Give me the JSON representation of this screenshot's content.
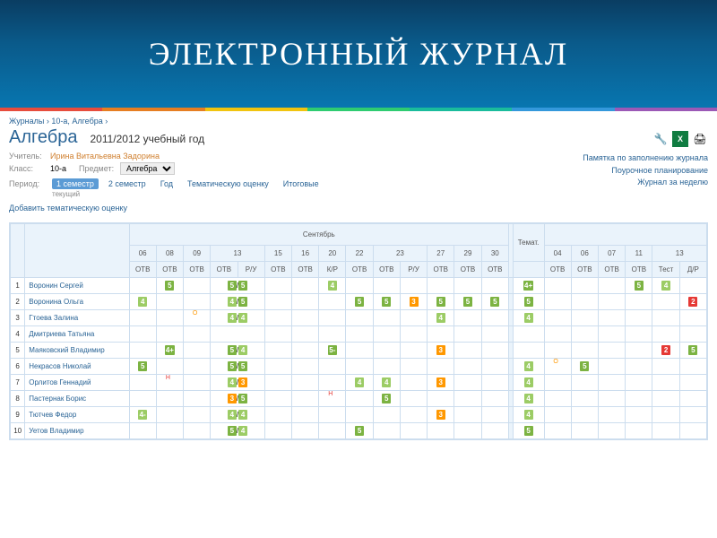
{
  "banner": {
    "title": "ЭЛЕКТРОННЫЙ ЖУРНАЛ"
  },
  "breadcrumb": {
    "journals": "Журналы",
    "class": "10-а, Алгебра"
  },
  "header": {
    "subject": "Алгебра",
    "year": "2011/2012 учебный год",
    "teacher_label": "Учитель:",
    "teacher": "Ирина Витальевна Задорина",
    "class_label": "Класс:",
    "class": "10-а",
    "subject_label": "Предмет:",
    "subject_select": "Алгебра",
    "period_label": "Период:",
    "period_tabs": [
      "1 семестр",
      "2 семестр",
      "Год",
      "Тематическую оценку",
      "Итоговые"
    ],
    "period_sub": "текущий",
    "add_thematic": "Добавить тематическую оценку"
  },
  "links": {
    "memo": "Памятка по заполнению журнала",
    "planning": "Поурочное планирование",
    "week": "Журнал за неделю"
  },
  "columns": {
    "month": "Сентябрь",
    "dates": [
      "06",
      "08",
      "09",
      "13",
      "15",
      "16",
      "20",
      "22",
      "23",
      "27",
      "29",
      "30"
    ],
    "types": [
      "ОТВ",
      "ОТВ",
      "ОТВ",
      "ОТВ",
      "Р/У",
      "ОТВ",
      "ОТВ",
      "К/Р",
      "ОТВ",
      "ОТВ",
      "Р/У",
      "ОТВ",
      "ОТВ",
      "ОТВ"
    ],
    "themat": "Темат.",
    "dates2": [
      "04",
      "06",
      "07",
      "11",
      "13"
    ],
    "types2": [
      "ОТВ",
      "ОТВ",
      "ОТВ",
      "ОТВ",
      "Тест",
      "Д/Р"
    ]
  },
  "students": [
    {
      "n": "1",
      "name": "Воронин Сергей"
    },
    {
      "n": "2",
      "name": "Воронина Ольга"
    },
    {
      "n": "3",
      "name": "Гтоева Залина"
    },
    {
      "n": "4",
      "name": "Дмитриева Татьяна"
    },
    {
      "n": "5",
      "name": "Маяковский Владимир"
    },
    {
      "n": "6",
      "name": "Некрасов Николай"
    },
    {
      "n": "7",
      "name": "Орлитов Геннадий"
    },
    {
      "n": "8",
      "name": "Пастернак Борис"
    },
    {
      "n": "9",
      "name": "Тютчев Федор"
    },
    {
      "n": "10",
      "name": "Уетов Владимир"
    }
  ],
  "grades": {
    "r1": {
      "c2": "5",
      "c4": "5/5",
      "c8": "4",
      "c15": "4+",
      "c19": "5",
      "c20": "4"
    },
    "r2": {
      "c1": "4",
      "c4": "4/5",
      "c9": "5",
      "c10": "5",
      "c11": "3",
      "c12": "5",
      "c13": "5",
      "c14": "5",
      "c15": "5",
      "c21": "2"
    },
    "r3": {
      "c3o": "О",
      "c4": "4/4",
      "c12": "4",
      "c15": "4"
    },
    "r4": {},
    "r5": {
      "c2": "4+",
      "c4": "5/4",
      "c8": "5-",
      "c12": "3",
      "c20": "2",
      "c21": "5"
    },
    "r6": {
      "c1": "5",
      "c4": "5/5",
      "c15": "4",
      "c16o": "О",
      "c17": "5"
    },
    "r7": {
      "c2n": "Н",
      "c4": "4/3",
      "c9": "4",
      "c10": "4",
      "c12": "3",
      "c15": "4"
    },
    "r8": {
      "c4": "3/5",
      "c8n": "Н",
      "c10": "5",
      "c15": "4"
    },
    "r9": {
      "c1": "4-",
      "c4": "4/4",
      "c12": "3",
      "c15": "4"
    },
    "r10": {
      "c4": "5/4",
      "c9": "5",
      "c15": "5"
    }
  }
}
